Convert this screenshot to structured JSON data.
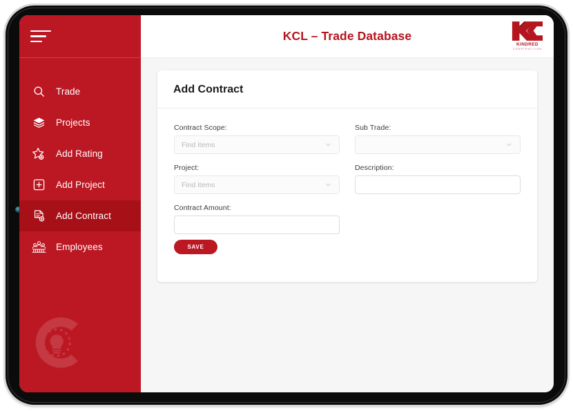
{
  "colors": {
    "brand_red": "#bc1823",
    "brand_red_dark": "#a81018",
    "title_red": "#b5151f",
    "content_bg": "#f6f6f6",
    "card_bg": "#ffffff",
    "bezel": "#0b0b0b"
  },
  "header": {
    "menu_icon": "hamburger-menu-icon",
    "title": "KCL – Trade Database",
    "logo": {
      "mark": "KC",
      "name": "KINDRED",
      "sub": "CONSTRUCTION"
    }
  },
  "sidebar": {
    "items": [
      {
        "label": "Trade",
        "icon": "search-icon",
        "active": false
      },
      {
        "label": "Projects",
        "icon": "layers-icon",
        "active": false
      },
      {
        "label": "Add Rating",
        "icon": "star-plus-icon",
        "active": false
      },
      {
        "label": "Add Project",
        "icon": "square-plus-icon",
        "active": false
      },
      {
        "label": "Add Contract",
        "icon": "document-plus-icon",
        "active": true
      },
      {
        "label": "Employees",
        "icon": "people-group-icon",
        "active": false
      }
    ],
    "watermark_icon": "c-lightbulb-watermark-icon"
  },
  "main": {
    "card_title": "Add Contract",
    "fields": {
      "contract_scope": {
        "label": "Contract Scope:",
        "placeholder": "Find items",
        "value": "",
        "type": "select"
      },
      "sub_trade": {
        "label": "Sub Trade:",
        "placeholder": "",
        "value": "",
        "type": "select"
      },
      "project": {
        "label": "Project:",
        "placeholder": "Find items",
        "value": "",
        "type": "select"
      },
      "description": {
        "label": "Description:",
        "placeholder": "",
        "value": "",
        "type": "text"
      },
      "contract_amount": {
        "label": "Contract Amount:",
        "placeholder": "",
        "value": "",
        "type": "text"
      }
    },
    "save_label": "SAVE"
  }
}
